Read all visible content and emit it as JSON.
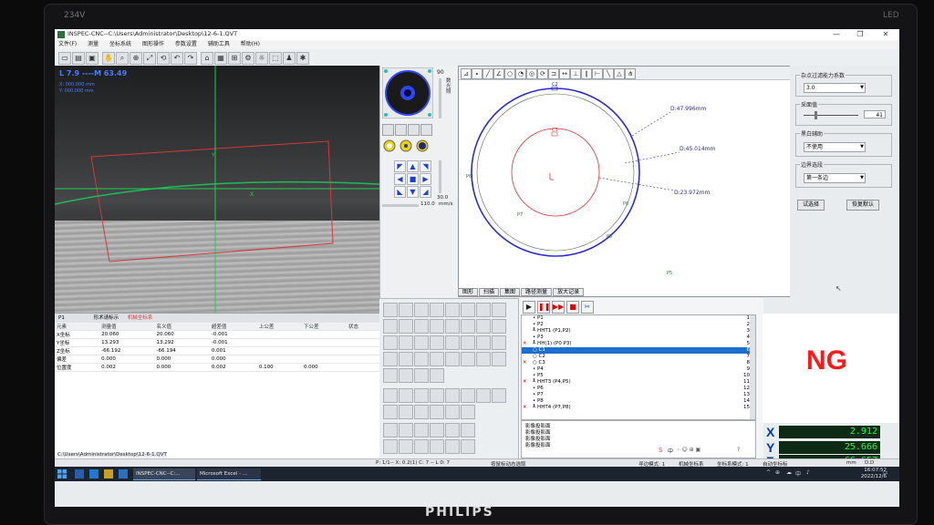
{
  "monitor": {
    "model": "234V",
    "led": "LED",
    "brand": "PHILIPS"
  },
  "window": {
    "title": "INSPEC-CNC--C:\\Users\\Administrator\\Desktop\\12-6-1.QVT"
  },
  "menu": [
    "文件(F)",
    "测量",
    "坐标系统",
    "图形操作",
    "参数设置",
    "辅助工具",
    "帮助(H)"
  ],
  "camera": {
    "readout": "L 7.9 ----M 63.49",
    "sub1": "X: 000.000 mm",
    "sub2": "Y: 000.000 mm",
    "axis_y": "Y",
    "axis_x": "X"
  },
  "results": {
    "item": "P1",
    "tabs": [
      "形术请标示",
      "机械坐标系"
    ],
    "columns": [
      "元素",
      "测量值",
      "名义值",
      "超差值",
      "上公差",
      "下公差",
      "状态"
    ],
    "rows": [
      [
        "X坐标",
        "20.060",
        "20.060",
        "-0.001",
        "",
        "",
        ""
      ],
      [
        "Y坐标",
        "13.293",
        "13.292",
        "-0.001",
        "",
        "",
        ""
      ],
      [
        "Z坐标",
        "-66.192",
        "-66.194",
        "0.001",
        "",
        "",
        ""
      ],
      [
        "偏差",
        "0.000",
        "0.000",
        "0.000",
        "",
        "",
        ""
      ],
      [
        "位置度",
        "0.002",
        "0.000",
        "0.002",
        "0.100",
        "0.000",
        ""
      ]
    ]
  },
  "statusbar": {
    "path": "C:\\Users\\Administrator\\Desktop\\12-6-1.QVT",
    "mid": "P: 1/1-- X: 0.2(1) C: 7 -- L 0: 7",
    "hint": "按鼠标动态选取",
    "mode": "寻边模式: 1",
    "coord": "机械坐标系",
    "coord2": "坐标系模式: 1",
    "auto": "自动坐标标",
    "unit": "mm",
    "dd": "D.D"
  },
  "controls": {
    "zoom_value": "90",
    "side_label": "数光照",
    "speed_value": "30.0",
    "speed_value2": "110.0",
    "speed_unit": "mm/s"
  },
  "drawing": {
    "d_outer": "D:47.996mm",
    "d_mid": "D:45.014mm",
    "d_inner": "D:23.972mm",
    "labels": [
      "C2",
      "C3",
      "P6",
      "P7",
      "P8",
      "P5"
    ],
    "tabs": [
      "图形",
      "扫描",
      "集图",
      "路径测量",
      "放大记录"
    ]
  },
  "props": {
    "g1_label": "杂点过滤能力系数",
    "g1_value": "3.0",
    "g2_label": "采面值",
    "g2_value": "41",
    "g3_label": "黑白辅助",
    "g3_value": "不使用",
    "g4_label": "边界选段",
    "g4_value": "第一条边",
    "btn_test": "试选择",
    "btn_restore": "恢复默认"
  },
  "program": {
    "lines": [
      {
        "mark": "",
        "text": "• P1",
        "n": "1"
      },
      {
        "mark": "",
        "text": "• P2",
        "n": "2"
      },
      {
        "mark": "",
        "text": "┸ HHT1 (P1,P2)",
        "n": "3"
      },
      {
        "mark": "",
        "text": "• P3",
        "n": "4"
      },
      {
        "mark": "✕",
        "text": "┸ HH(1) (P0 P3)",
        "n": "5"
      },
      {
        "mark": "",
        "text": "○ C1",
        "n": "6"
      },
      {
        "mark": "",
        "text": "○ C2",
        "n": "7"
      },
      {
        "mark": "✕",
        "text": "○ C3",
        "n": "8"
      },
      {
        "mark": "",
        "text": "• P4",
        "n": "9"
      },
      {
        "mark": "",
        "text": "• P5",
        "n": "10"
      },
      {
        "mark": "✕",
        "text": "┸ HHT3 (P4,P5)",
        "n": "11"
      },
      {
        "mark": "",
        "text": "• P6",
        "n": "12"
      },
      {
        "mark": "",
        "text": "• P7",
        "n": "13"
      },
      {
        "mark": "",
        "text": "• P8",
        "n": "14"
      },
      {
        "mark": "✕",
        "text": "┸ HHT4 (P7,P8)",
        "n": "15"
      }
    ],
    "tasks": [
      "影像投影面",
      "影像投影面",
      "影像投影面",
      "影像投影面"
    ]
  },
  "result_status": "NG",
  "dro": {
    "x": "2.912",
    "y": "25.666",
    "z": "-66.657",
    "xl": "X",
    "yl": "Y",
    "zl": "Z"
  },
  "taskbar": {
    "app1": "INSPEC-CNC--C:...",
    "app2": "Microsoft Excel - ...",
    "time": "16:07:52",
    "date": "2022/12/6",
    "ime": "中"
  },
  "colors": {
    "ng": "#ff1a1a",
    "dro_text": "#20ff3a",
    "dro_bg": "#0c2a14",
    "axis_label": "#003ba8"
  }
}
